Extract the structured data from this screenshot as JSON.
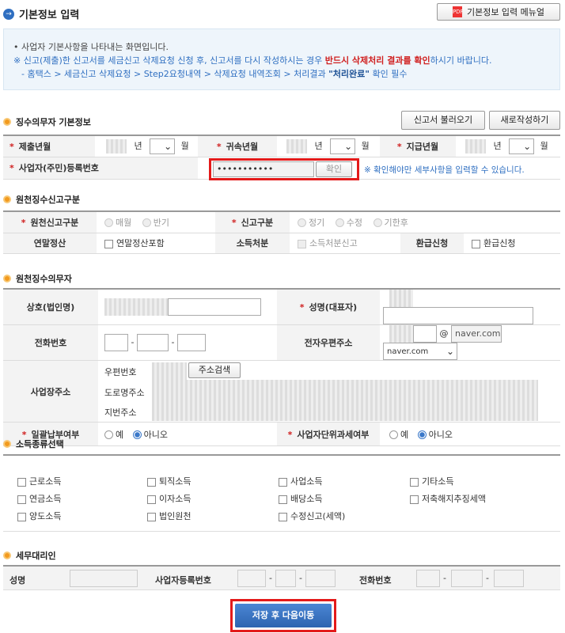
{
  "header": {
    "icon": "→",
    "title": "기본정보 입력",
    "manual_button": "기본정보 입력 메뉴얼"
  },
  "notice": {
    "line1": "• 사업자 기본사항을 나타내는 화면입니다.",
    "line2_prefix": "※ 신고(제출)한 신고서를 세금신고 삭제요청 신청 후, 신고서를 다시 작성하시는 경우 ",
    "line2_red": "반드시 삭제처리 결과를 확인",
    "line2_suffix": "하시기 바랍니다.",
    "line3_prefix": "- 홈택스 > 세금신고 삭제요청 > Step2요청내역 > 삭제요청 내역조회 > 처리결과 ",
    "line3_bold": "\"처리완료\"",
    "line3_suffix": " 확인 필수"
  },
  "basic": {
    "title": "징수의무자 기본정보",
    "load_button": "신고서 불러오기",
    "new_button": "새로작성하기",
    "submit_ym": "제출년월",
    "belong_ym": "귀속년월",
    "pay_ym": "지급년월",
    "year": "년",
    "month": "월",
    "bizno_label": "사업자(주민)등록번호",
    "bizno_value": "•••••••••••",
    "confirm_button": "확인",
    "confirm_hint": "※ 확인해야만 세부사항을 입력할 수 있습니다."
  },
  "withholding_type": {
    "title": "원천징수신고구분",
    "type_label": "원천신고구분",
    "opt_monthly": "매월",
    "opt_half": "반기",
    "report_label": "신고구분",
    "opt_regular": "정기",
    "opt_amend": "수정",
    "opt_late": "기한후",
    "yearend_label": "연말정산",
    "yearend_check": "연말정산포함",
    "income_label": "소득처분",
    "income_check": "소득처분신고",
    "refund_label": "환급신청",
    "refund_check": "환급신청"
  },
  "agent": {
    "title": "원천징수의무자",
    "company_label": "상호(법인명)",
    "rep_label": "성명(대표자)",
    "phone_label": "전화번호",
    "email_label": "전자우편주소",
    "email_at": "@",
    "email_domain": "naver.com",
    "email_select": "naver.com",
    "addr_label": "사업장주소",
    "zip_label": "우편번호",
    "search_button": "주소검색",
    "road_label": "도로명주소",
    "lot_label": "지번주소",
    "lump_label": "일괄납부여부",
    "unit_label": "사업자단위과세여부",
    "yes": "예",
    "no": "아니오"
  },
  "income_types": {
    "title": "소득종류선택",
    "items": [
      "근로소득",
      "퇴직소득",
      "사업소득",
      "기타소득",
      "연금소득",
      "이자소득",
      "배당소득",
      "저축해지추징세액",
      "양도소득",
      "법인원천",
      "수정신고(세액)"
    ]
  },
  "tax_agent": {
    "title": "세무대리인",
    "name_label": "성명",
    "bizno_label": "사업자등록번호",
    "phone_label": "전화번호"
  },
  "footer": {
    "save_button": "저장 후 다음이동"
  },
  "colors": {
    "accent": "#2f6fc1",
    "highlight": "#e31a1a",
    "orange": "#f29a1e"
  }
}
